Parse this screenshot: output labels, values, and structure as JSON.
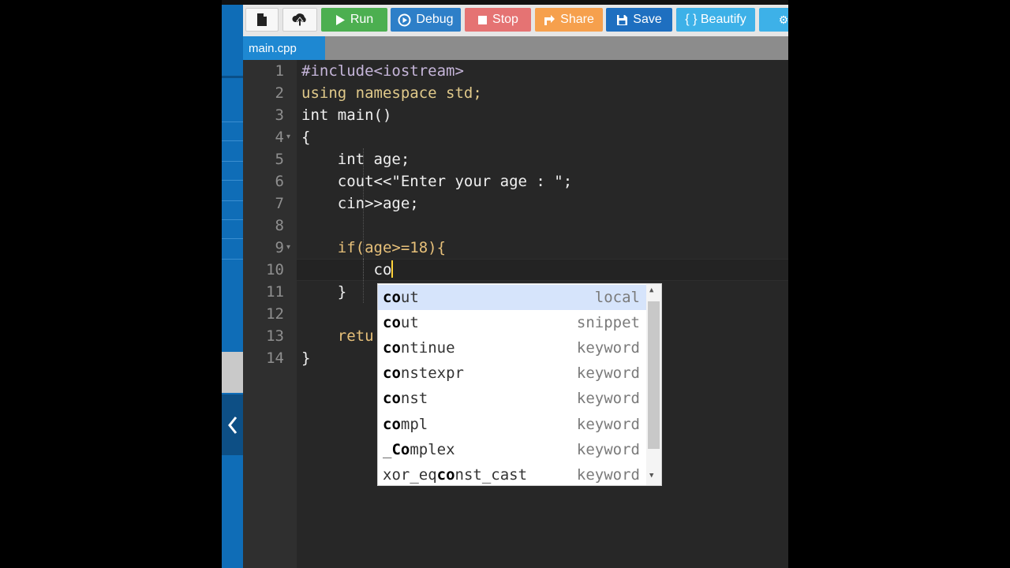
{
  "toolbar": {
    "new_icon": "file-icon",
    "upload_icon": "upload-icon",
    "run_label": "Run",
    "debug_label": "Debug",
    "stop_label": "Stop",
    "share_label": "Share",
    "save_label": "Save",
    "beautify_label": "{ } Beautify"
  },
  "tab": {
    "label": "main.cpp"
  },
  "editor": {
    "lines": [
      {
        "n": "1",
        "text": "#include<iostream>"
      },
      {
        "n": "2",
        "text": "using namespace std;"
      },
      {
        "n": "3",
        "text": "int main()"
      },
      {
        "n": "4",
        "text": "{"
      },
      {
        "n": "5",
        "text": "    int age;"
      },
      {
        "n": "6",
        "text": "    cout<<\"Enter your age : \";"
      },
      {
        "n": "7",
        "text": "    cin>>age;"
      },
      {
        "n": "8",
        "text": ""
      },
      {
        "n": "9",
        "text": "    if(age>=18){"
      },
      {
        "n": "10",
        "text": "        co"
      },
      {
        "n": "11",
        "text": "    }"
      },
      {
        "n": "12",
        "text": ""
      },
      {
        "n": "13",
        "text": "    retu"
      },
      {
        "n": "14",
        "text": "}"
      }
    ]
  },
  "autocomplete": {
    "items": [
      {
        "prefix": "co",
        "rest": "ut",
        "kind": "local"
      },
      {
        "prefix": "co",
        "rest": "ut",
        "kind": "snippet"
      },
      {
        "prefix": "co",
        "rest": "ntinue",
        "kind": "keyword"
      },
      {
        "prefix": "co",
        "rest": "nstexpr",
        "kind": "keyword"
      },
      {
        "prefix": "co",
        "rest": "nst",
        "kind": "keyword"
      },
      {
        "prefix": "co",
        "rest": "mpl",
        "kind": "keyword"
      },
      {
        "pre": "_",
        "prefix": "Co",
        "rest": "mplex",
        "kind": "keyword"
      },
      {
        "pre": "xor_eq",
        "prefix": "co",
        "rest": "nst_cast",
        "kind": "keyword"
      }
    ]
  },
  "colors": {
    "sidebar": "#0f6db7",
    "run": "#4caf50",
    "debug": "#2d7fc8",
    "stop": "#e57373",
    "share": "#f6a04d",
    "save": "#1e6fc0",
    "beautify": "#3db1e8"
  }
}
